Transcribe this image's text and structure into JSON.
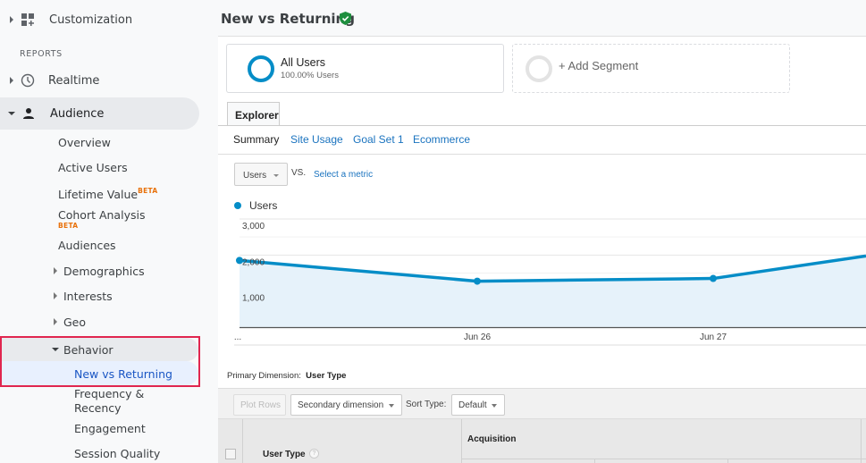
{
  "sidebar": {
    "customization": "Customization",
    "reports_label": "REPORTS",
    "realtime": "Realtime",
    "audience": "Audience",
    "audience_items": {
      "overview": "Overview",
      "active_users": "Active Users",
      "lifetime_value": "Lifetime Value",
      "lifetime_value_badge": "BETA",
      "cohort_analysis": "Cohort Analysis",
      "cohort_analysis_badge": "BETA",
      "audiences": "Audiences",
      "demographics": "Demographics",
      "interests": "Interests",
      "geo": "Geo",
      "behavior": "Behavior"
    },
    "behavior_items": {
      "new_vs_returning": "New vs Returning",
      "frequency_recency_1": "Frequency &",
      "frequency_recency_2": "Recency",
      "engagement": "Engagement",
      "session_quality": "Session Quality"
    }
  },
  "header": {
    "title": "New vs Returning",
    "verified_icon": "shield-check-icon"
  },
  "segments": {
    "all_users": {
      "name": "All Users",
      "sub": "100.00% Users"
    },
    "add_segment": "+ Add Segment"
  },
  "tabs": {
    "explorer": "Explorer",
    "subtabs": [
      "Summary",
      "Site Usage",
      "Goal Set 1",
      "Ecommerce"
    ]
  },
  "metric": {
    "selected": "Users",
    "vs": "VS.",
    "select_metric": "Select a metric"
  },
  "colors": {
    "series": "#058dc7",
    "area": "#e6f2fa",
    "highlight": "#e0264f",
    "link": "#1a73bf",
    "verified": "#1e8e3e"
  },
  "chart_data": {
    "type": "area",
    "title": "",
    "legend": [
      {
        "name": "Users",
        "color": "#058dc7"
      }
    ],
    "legend_placement": "top-left",
    "x": [
      "...",
      "Jun 26",
      "Jun 27",
      ""
    ],
    "x_tick_labels": [
      "...",
      "Jun 26",
      "Jun 27"
    ],
    "series": [
      {
        "name": "Users",
        "values": [
          1850,
          1275,
          1350,
          1975
        ]
      }
    ],
    "y_tick_labels": [
      "3,000",
      "2,000",
      "1,000"
    ],
    "y_ticks": [
      1000,
      2000,
      3000
    ],
    "ylim": [
      0,
      3000
    ],
    "grid": true,
    "xlabel": "",
    "ylabel": ""
  },
  "table": {
    "primary_dimension_label": "Primary Dimension:",
    "primary_dimension_value": "User Type",
    "plot_rows": "Plot Rows",
    "secondary_dimension": "Secondary dimension",
    "sort_type_label": "Sort Type:",
    "sort_type_value": "Default",
    "col_user_type": "User Type",
    "help": "?",
    "group_acquisition": "Acquisition"
  }
}
